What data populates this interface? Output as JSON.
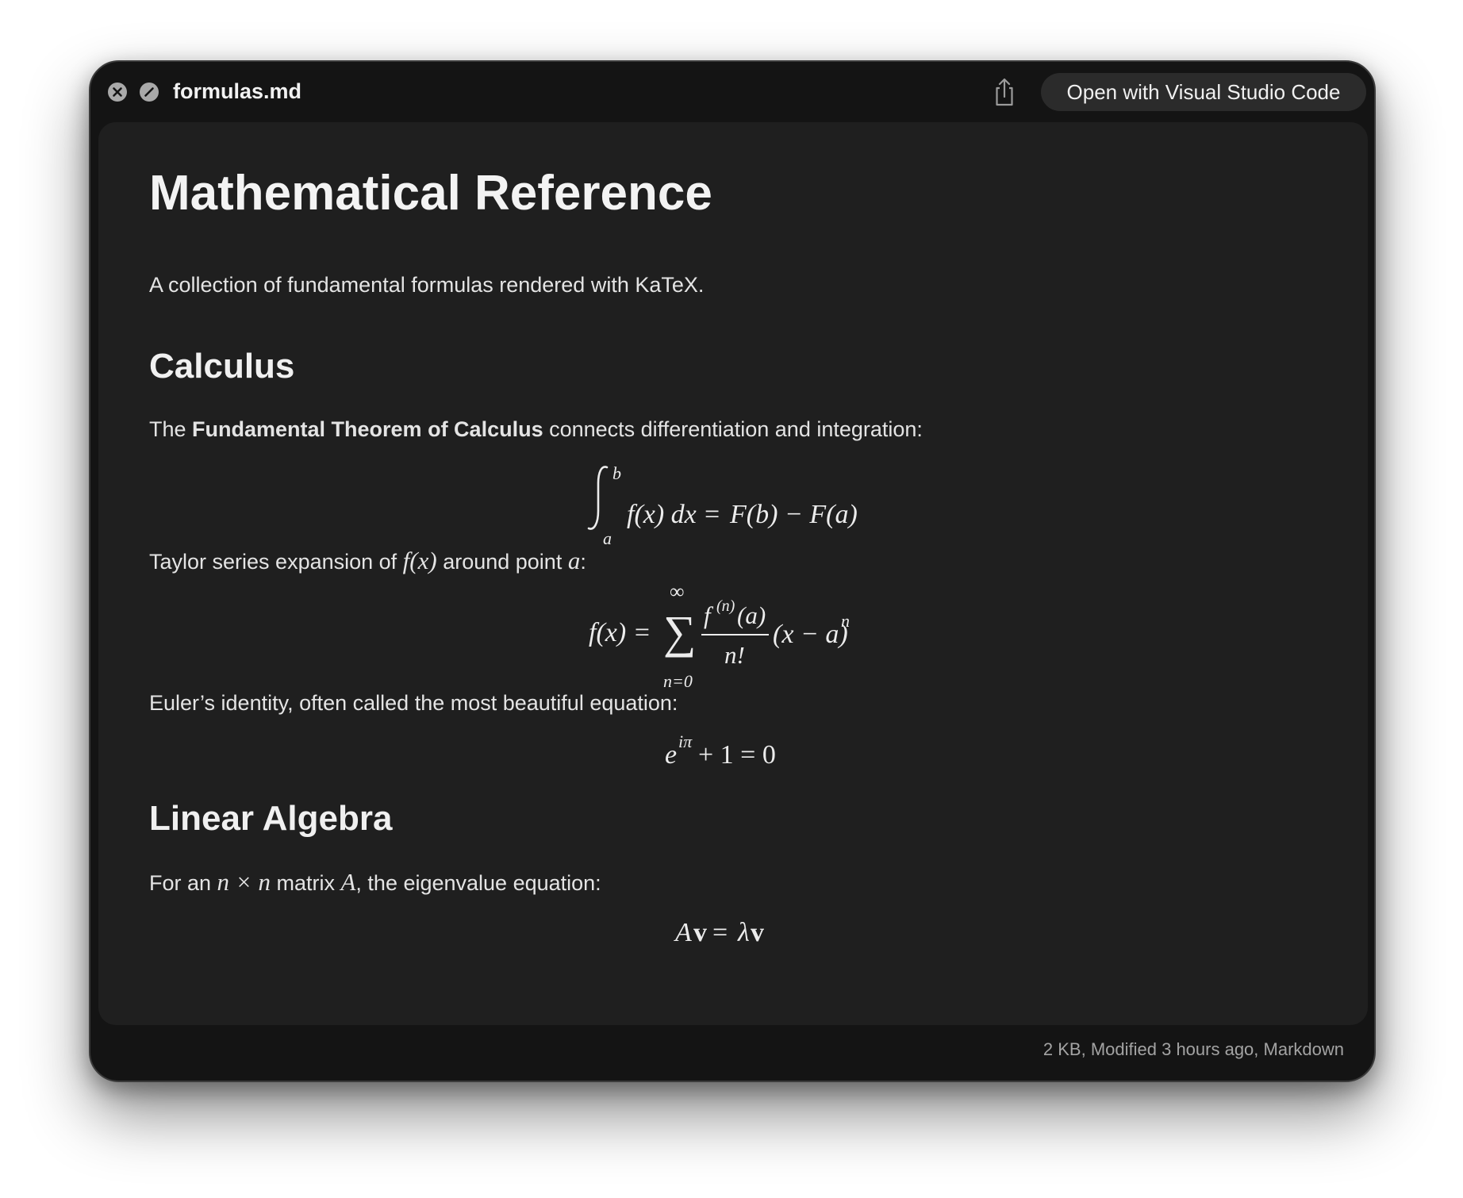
{
  "window": {
    "filename": "formulas.md",
    "open_with_label": "Open with Visual Studio Code",
    "status": "2 KB, Modified 3 hours ago, Markdown"
  },
  "icons": {
    "close": "close-icon",
    "fullscreen": "fullscreen-icon",
    "share": "share-icon"
  },
  "document": {
    "title": "Mathematical Reference",
    "intro": "A collection of fundamental formulas rendered with KaTeX.",
    "calculus": {
      "heading": "Calculus",
      "ftc_prefix": "The ",
      "ftc_bold": "Fundamental Theorem of Calculus",
      "ftc_suffix": " connects differentiation and integration:",
      "ftc_formula": {
        "lower": "a",
        "upper": "b",
        "integrand": "f(x) dx",
        "eq": "=",
        "rhs": "F(b) − F(a)"
      },
      "taylor_prefix": "Taylor series expansion of ",
      "taylor_fx": "f(x)",
      "taylor_mid": " around point ",
      "taylor_a": "a",
      "taylor_suffix": ":",
      "taylor_formula": {
        "lhs": "f(x) =",
        "sum": "∑",
        "upper": "∞",
        "lower": "n=0",
        "num_f": "f",
        "num_sup": "(n)",
        "num_arg": "(a)",
        "den": "n!",
        "tail": "(x − a)",
        "tail_sup": "n"
      },
      "euler_text": "Euler’s identity, often called the most beautiful equation:",
      "euler_formula": {
        "base": "e",
        "sup": "iπ",
        "rest": "+ 1 = 0"
      }
    },
    "linear_algebra": {
      "heading": "Linear Algebra",
      "eigen_prefix": "For an ",
      "eigen_nxn": "n × n",
      "eigen_mid": " matrix ",
      "eigen_A": "A",
      "eigen_suffix": ", the eigenvalue equation:",
      "eigen_formula": {
        "A": "A",
        "v1": "v",
        "eq": "=",
        "lambda": "λ",
        "v2": "v"
      }
    }
  }
}
